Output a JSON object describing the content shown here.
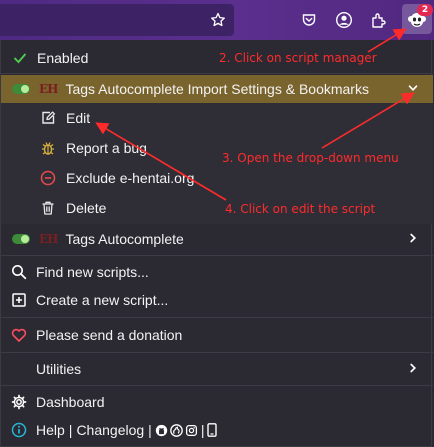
{
  "colors": {
    "toolbar": "#51287f",
    "panel": "#2b2a33",
    "highlight": "#7a642e",
    "annotation": "#ff2b2b",
    "badge": "#e22850",
    "toggle_on": "#3c8a3a"
  },
  "toolbar": {
    "icons": [
      "star-icon",
      "pocket-icon",
      "account-icon",
      "extensions-icon",
      "violentmonkey-icon"
    ],
    "badge_count": "2"
  },
  "menu": {
    "enabled_label": "Enabled",
    "script_active": {
      "logo_text": "EH",
      "name": "Tags Autocomplete Import Settings & Bookmarks",
      "actions": {
        "edit": "Edit",
        "report_bug": "Report a bug",
        "exclude": "Exclude e-hentai.org",
        "delete": "Delete"
      }
    },
    "script_second": {
      "logo_text": "EH",
      "name": "Tags Autocomplete"
    },
    "find_scripts": "Find new scripts...",
    "create_script": "Create a new script...",
    "donation": "Please send a donation",
    "utilities": "Utilities",
    "dashboard": "Dashboard",
    "footer": {
      "help": "Help",
      "sep1": "|",
      "changelog": "Changelog",
      "sep2": "|"
    }
  },
  "annotations": {
    "step2": "2. Click on script manager",
    "step3": "3. Open the drop-down menu",
    "step4": "4. Click on edit the script"
  }
}
